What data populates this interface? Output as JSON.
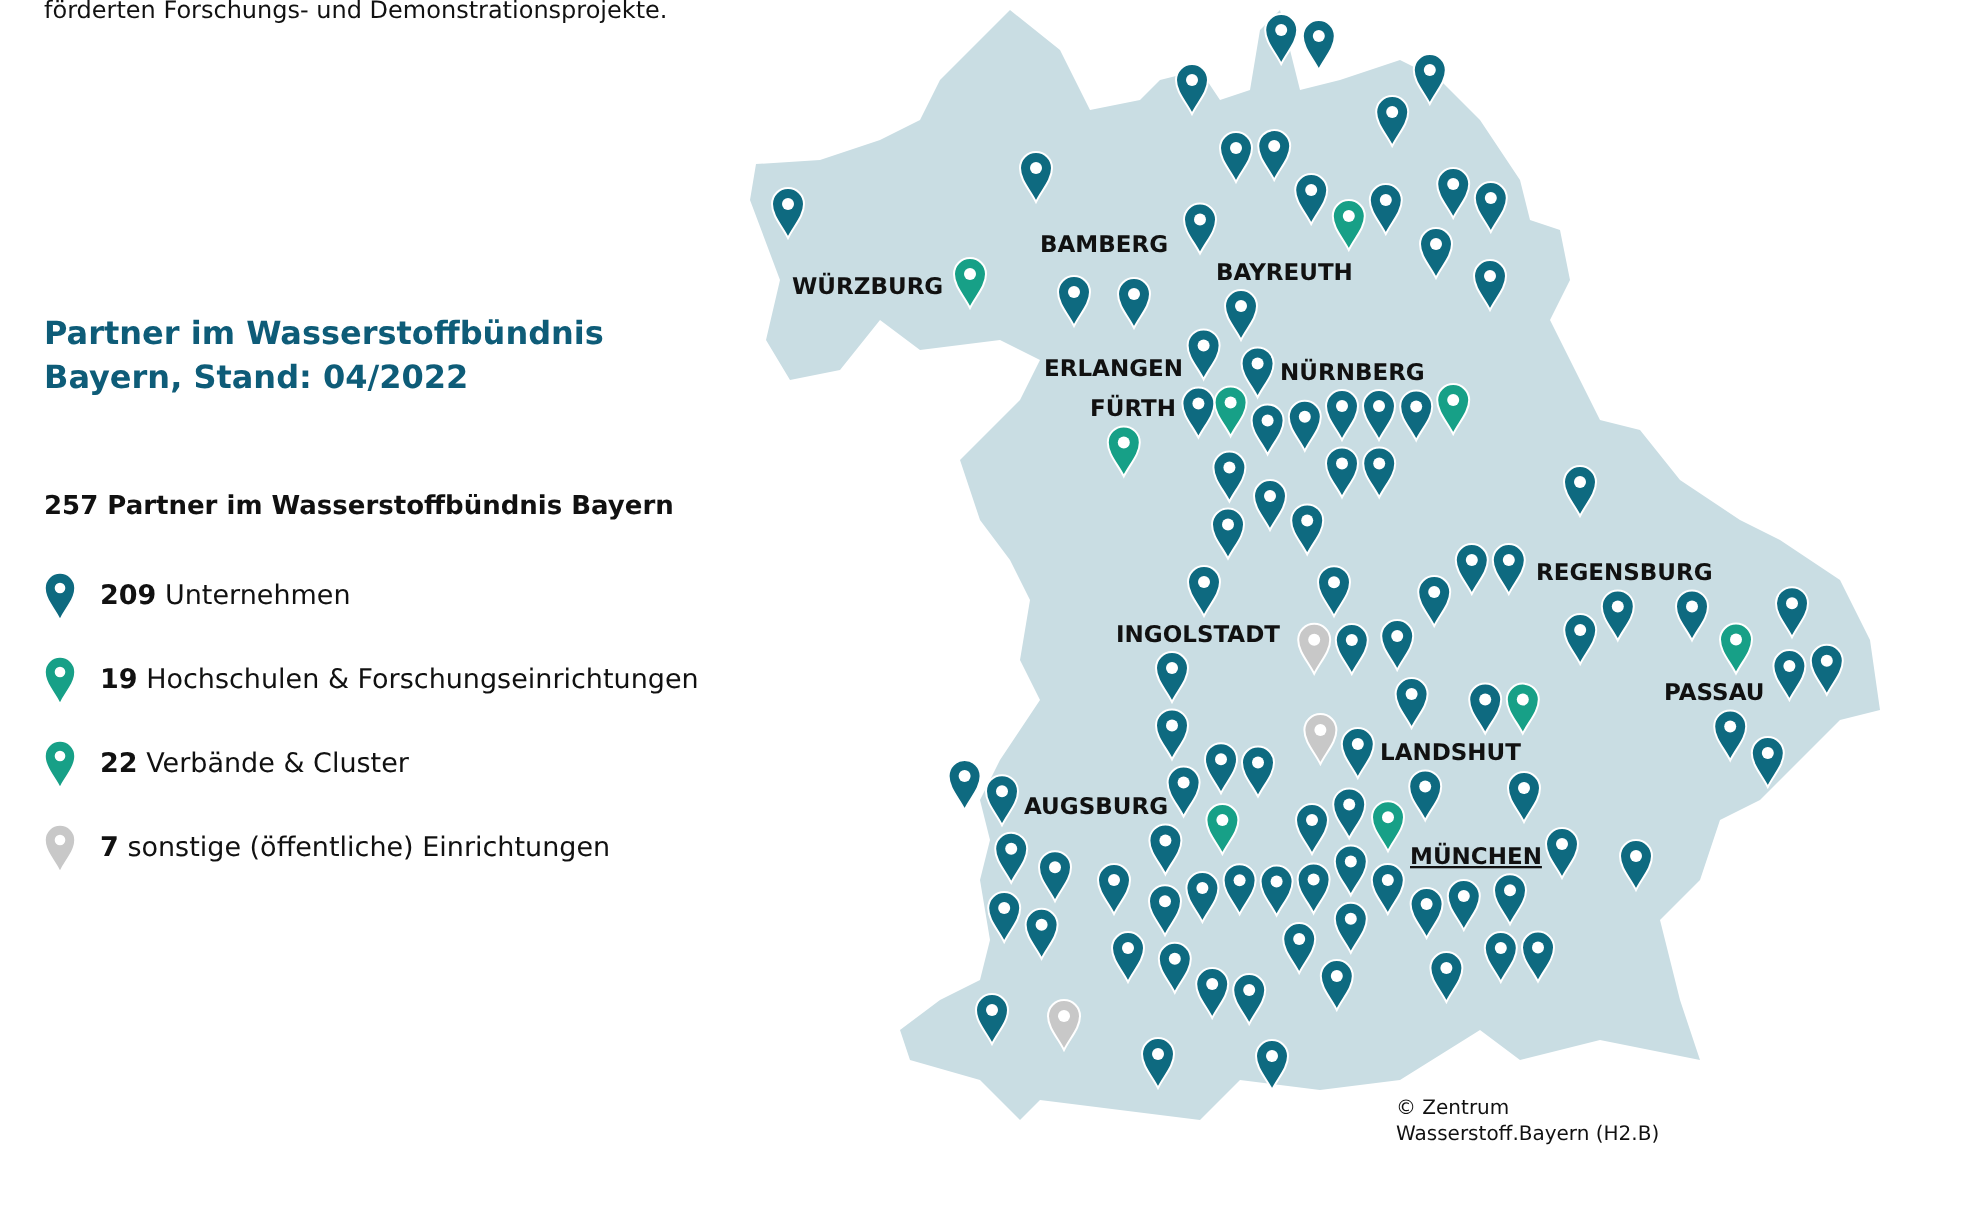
{
  "intro_text": "förderten Forschungs- und Demonstrationsprojekte.",
  "title": "Partner im Wasserstoffbündnis Bayern, Stand: 04/2022",
  "legend": {
    "heading": "257 Partner im Wasserstoffbündnis Bayern",
    "items": [
      {
        "kind": "company",
        "color": "#0e6a80",
        "label": "**209** Unternehmen"
      },
      {
        "kind": "university",
        "color": "#17a087",
        "label": "**19** Hochschulen & Forschungseinrichtungen"
      },
      {
        "kind": "association",
        "color": "#17a087",
        "label": "**22** Verbände & Cluster"
      },
      {
        "kind": "other",
        "color": "#c8c8c8",
        "label": "**7** sonstige (öffentliche) Einrichtungen"
      }
    ]
  },
  "map": {
    "cities": [
      {
        "name": "WÜRZBURG",
        "underlined": false
      },
      {
        "name": "BAMBERG",
        "underlined": false
      },
      {
        "name": "BAYREUTH",
        "underlined": false
      },
      {
        "name": "ERLANGEN",
        "underlined": false
      },
      {
        "name": "NÜRNBERG",
        "underlined": false
      },
      {
        "name": "FÜRTH",
        "underlined": false
      },
      {
        "name": "REGENSBURG",
        "underlined": false
      },
      {
        "name": "INGOLSTADT",
        "underlined": false
      },
      {
        "name": "PASSAU",
        "underlined": false
      },
      {
        "name": "LANDSHUT",
        "underlined": false
      },
      {
        "name": "AUGSBURG",
        "underlined": false
      },
      {
        "name": "MÜNCHEN",
        "underlined": true
      }
    ],
    "pins": [
      {
        "kind": "company"
      },
      {
        "kind": "company"
      },
      {
        "kind": "company"
      },
      {
        "kind": "company"
      },
      {
        "kind": "company"
      },
      {
        "kind": "company"
      },
      {
        "kind": "company"
      },
      {
        "kind": "company"
      },
      {
        "kind": "company"
      },
      {
        "kind": "company"
      },
      {
        "kind": "company"
      },
      {
        "kind": "company"
      },
      {
        "kind": "company"
      },
      {
        "kind": "company"
      },
      {
        "kind": "university"
      },
      {
        "kind": "company"
      },
      {
        "kind": "company"
      },
      {
        "kind": "university"
      },
      {
        "kind": "company"
      },
      {
        "kind": "company"
      },
      {
        "kind": "company"
      },
      {
        "kind": "company"
      },
      {
        "kind": "company"
      },
      {
        "kind": "company"
      },
      {
        "kind": "company"
      },
      {
        "kind": "company"
      },
      {
        "kind": "association"
      },
      {
        "kind": "company"
      },
      {
        "kind": "company"
      },
      {
        "kind": "company"
      },
      {
        "kind": "company"
      },
      {
        "kind": "company"
      },
      {
        "kind": "university"
      },
      {
        "kind": "university"
      },
      {
        "kind": "company"
      },
      {
        "kind": "company"
      },
      {
        "kind": "company"
      },
      {
        "kind": "company"
      },
      {
        "kind": "company"
      },
      {
        "kind": "company"
      },
      {
        "kind": "company"
      },
      {
        "kind": "company"
      },
      {
        "kind": "company"
      },
      {
        "kind": "company"
      },
      {
        "kind": "company"
      },
      {
        "kind": "company"
      },
      {
        "kind": "company"
      },
      {
        "kind": "association"
      },
      {
        "kind": "company"
      },
      {
        "kind": "other"
      },
      {
        "kind": "company"
      },
      {
        "kind": "company"
      },
      {
        "kind": "company"
      },
      {
        "kind": "company"
      },
      {
        "kind": "company"
      },
      {
        "kind": "company"
      },
      {
        "kind": "company"
      },
      {
        "kind": "company"
      },
      {
        "kind": "other"
      },
      {
        "kind": "company"
      },
      {
        "kind": "company"
      },
      {
        "kind": "company"
      },
      {
        "kind": "association"
      },
      {
        "kind": "company"
      },
      {
        "kind": "company"
      },
      {
        "kind": "company"
      },
      {
        "kind": "company"
      },
      {
        "kind": "company"
      },
      {
        "kind": "company"
      },
      {
        "kind": "association"
      },
      {
        "kind": "company"
      },
      {
        "kind": "company"
      },
      {
        "kind": "association"
      },
      {
        "kind": "company"
      },
      {
        "kind": "company"
      },
      {
        "kind": "company"
      },
      {
        "kind": "company"
      },
      {
        "kind": "company"
      },
      {
        "kind": "company"
      },
      {
        "kind": "company"
      },
      {
        "kind": "company"
      },
      {
        "kind": "company"
      },
      {
        "kind": "company"
      },
      {
        "kind": "company"
      },
      {
        "kind": "company"
      },
      {
        "kind": "company"
      },
      {
        "kind": "company"
      },
      {
        "kind": "company"
      },
      {
        "kind": "company"
      },
      {
        "kind": "company"
      },
      {
        "kind": "company"
      },
      {
        "kind": "company"
      },
      {
        "kind": "company"
      },
      {
        "kind": "company"
      },
      {
        "kind": "company"
      },
      {
        "kind": "company"
      },
      {
        "kind": "company"
      },
      {
        "kind": "company"
      },
      {
        "kind": "company"
      },
      {
        "kind": "company"
      },
      {
        "kind": "company"
      },
      {
        "kind": "company"
      },
      {
        "kind": "company"
      },
      {
        "kind": "other"
      },
      {
        "kind": "company"
      },
      {
        "kind": "company"
      },
      {
        "kind": "company"
      }
    ],
    "copyright": "© Zentrum Wasserstoff.Bayern (H2.B)"
  }
}
